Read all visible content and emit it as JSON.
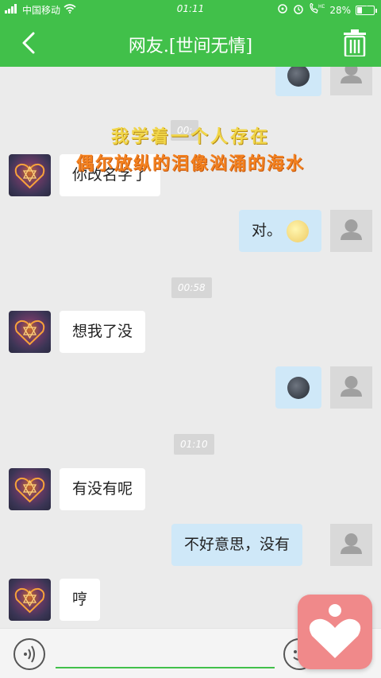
{
  "statusbar": {
    "carrier": "中国移动",
    "time": "01:11",
    "battery": "28%",
    "battery_level": 0.28
  },
  "navbar": {
    "title": "网友.[世间无情]"
  },
  "colors": {
    "brand_green": "#41c04a",
    "bubble_me": "#cfe8f8",
    "bubble_friend": "#ffffff",
    "overlay_yellow": "#f1d64a",
    "overlay_orange": "#f3811f",
    "floating_pink": "#f0898a"
  },
  "overlay": {
    "line1": "我学着一个人存在",
    "line2": "偶尔放纵的泪像汹涌的海水"
  },
  "messages": {
    "m0": {
      "sender": "me",
      "content_icon": "new-moon-face-emoji"
    },
    "t0": "00:",
    "m1": {
      "sender": "friend",
      "text": "你改名字了"
    },
    "m2": {
      "sender": "me",
      "text": "对。",
      "content_icon": "full-moon-face-emoji"
    },
    "t1": "00:58",
    "m3": {
      "sender": "friend",
      "text": "想我了没"
    },
    "m4": {
      "sender": "me",
      "content_icon": "new-moon-face-emoji"
    },
    "t2": "01:10",
    "m5": {
      "sender": "friend",
      "text": "有没有呢"
    },
    "m6": {
      "sender": "me",
      "text": "不好意思，没有"
    },
    "m7": {
      "sender": "friend",
      "text": "哼"
    }
  },
  "icons": {
    "back": "back-arrow-icon",
    "trash": "trash-icon",
    "voice": "voice-icon",
    "emoji": "emoji-face-icon",
    "floating": "heart-app-icon"
  }
}
